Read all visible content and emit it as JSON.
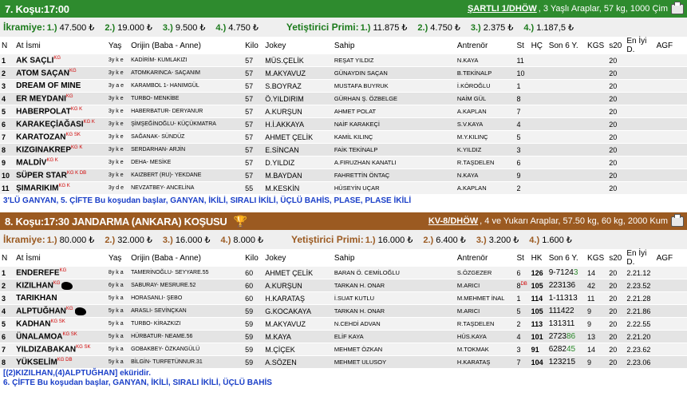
{
  "race7": {
    "title": "7. Koşu:17:00",
    "condition_code": "ŞARTLI 1/DHÖW",
    "condition_text": ", 3 Yaşlı Araplar, 57 kg, 1000 Çim",
    "prize_label": "İkramiye:",
    "prizes": [
      "1.) 47.500 ₺",
      "2.) 19.000 ₺",
      "3.) 9.500 ₺",
      "4.) 4.750 ₺"
    ],
    "breeder_label": "Yetiştirici Primi:",
    "breeder_prizes": [
      "1.) 11.875 ₺",
      "2.) 4.750 ₺",
      "3.) 2.375 ₺",
      "4.) 1.187,5 ₺"
    ],
    "columns": [
      "N",
      "At İsmi",
      "Yaş",
      "Orijin (Baba - Anne)",
      "Kilo",
      "Jokey",
      "Sahip",
      "Antrenör",
      "St",
      "HÇ",
      "Son 6 Y.",
      "KGS",
      "s20",
      "En İyi D.",
      "AGF"
    ],
    "rows": [
      {
        "no": "1",
        "name": "AK SAÇLI",
        "sup": "KG",
        "age": "3y k e",
        "origin": "KADİRİM- KUMLAKIZI",
        "kilo": "57",
        "jockey": "MÜS.ÇELİK",
        "owner": "REŞAT YILDIZ",
        "trainer": "N.KAYA",
        "st": "11",
        "hc": "",
        "son6": "",
        "kgs": "",
        "s20": "20",
        "best": "",
        "agf": ""
      },
      {
        "no": "2",
        "name": "ATOM SAÇAN",
        "sup": "KG",
        "age": "3y k e",
        "origin": "ATOMKARINCA- SAÇANIM",
        "kilo": "57",
        "jockey": "M.AKYAVUZ",
        "owner": "GÜNAYDIN SAÇAN",
        "trainer": "B.TEKİNALP",
        "st": "10",
        "hc": "",
        "son6": "",
        "kgs": "",
        "s20": "20",
        "best": "",
        "agf": ""
      },
      {
        "no": "3",
        "name": "DREAM OF MINE",
        "sup": "",
        "age": "3y a e",
        "origin": "KARAMBOL 1- HANIMGÜL",
        "kilo": "57",
        "jockey": "S.BOYRAZ",
        "owner": "MUSTAFA BUYRUK",
        "trainer": "İ.KÖROĞLU",
        "st": "1",
        "hc": "",
        "son6": "",
        "kgs": "",
        "s20": "20",
        "best": "",
        "agf": ""
      },
      {
        "no": "4",
        "name": "ER MEYDANI",
        "sup": "KG",
        "age": "3y k e",
        "origin": "TURBO- MENKİBE",
        "kilo": "57",
        "jockey": "Ö.YILDIRIM",
        "owner": "GÜRHAN Ş. ÖZBELGE",
        "trainer": "NAİM GÜL",
        "st": "8",
        "hc": "",
        "son6": "",
        "kgs": "",
        "s20": "20",
        "best": "",
        "agf": ""
      },
      {
        "no": "5",
        "name": "HABERPOLAT",
        "sup": "KG K",
        "age": "3y k e",
        "origin": "HABERBATUR- DERYANUR",
        "kilo": "57",
        "jockey": "A.KURŞUN",
        "owner": "AHMET POLAT",
        "trainer": "A.KAPLAN",
        "st": "7",
        "hc": "",
        "son6": "",
        "kgs": "",
        "s20": "20",
        "best": "",
        "agf": ""
      },
      {
        "no": "6",
        "name": "KARAKEÇİAĞASI",
        "sup": "KG K",
        "age": "3y k e",
        "origin": "ŞİMŞEĞİNOĞLU- KÜÇÜKMATRA",
        "kilo": "57",
        "jockey": "H.İ.AKKAYA",
        "owner": "NAİF KARAKEÇİ",
        "trainer": "S.V.KAYA",
        "st": "4",
        "hc": "",
        "son6": "",
        "kgs": "",
        "s20": "20",
        "best": "",
        "agf": ""
      },
      {
        "no": "7",
        "name": "KARATOZAN",
        "sup": "KG SK",
        "age": "3y k e",
        "origin": "SAĞANAK- SÜNDÜZ",
        "kilo": "57",
        "jockey": "AHMET ÇELİK",
        "owner": "KAMİL KILINÇ",
        "trainer": "M.Y.KILINÇ",
        "st": "5",
        "hc": "",
        "son6": "",
        "kgs": "",
        "s20": "20",
        "best": "",
        "agf": ""
      },
      {
        "no": "8",
        "name": "KIZGINAKREP",
        "sup": "KG K",
        "age": "3y k e",
        "origin": "SERDARHAN- ARJİN",
        "kilo": "57",
        "jockey": "E.SİNCAN",
        "owner": "FAİK TEKİNALP",
        "trainer": "K.YILDIZ",
        "st": "3",
        "hc": "",
        "son6": "",
        "kgs": "",
        "s20": "20",
        "best": "",
        "agf": ""
      },
      {
        "no": "9",
        "name": "MALDİV",
        "sup": "KG K",
        "age": "3y k e",
        "origin": "DEHA- MESİKE",
        "kilo": "57",
        "jockey": "D.YILDIZ",
        "owner": "A.FIRUZHAN KANATLI",
        "trainer": "R.TAŞDELEN",
        "st": "6",
        "hc": "",
        "son6": "",
        "kgs": "",
        "s20": "20",
        "best": "",
        "agf": ""
      },
      {
        "no": "10",
        "name": "SÜPER STAR",
        "sup": "KG K DB",
        "age": "3y k e",
        "origin": "KAIZBERT (RU)- YEKDANE",
        "kilo": "57",
        "jockey": "M.BAYDAN",
        "owner": "FAHRETTİN ÖNTAÇ",
        "trainer": "N.KAYA",
        "st": "9",
        "hc": "",
        "son6": "",
        "kgs": "",
        "s20": "20",
        "best": "",
        "agf": ""
      },
      {
        "no": "11",
        "name": "ŞIMARIKIM",
        "sup": "KG K",
        "age": "3y d e",
        "origin": "NEVZATBEY- ANCELİNA",
        "kilo": "55",
        "jockey": "M.KESKİN",
        "owner": "HÜSEYİN UÇAR",
        "trainer": "A.KAPLAN",
        "st": "2",
        "hc": "",
        "son6": "",
        "kgs": "",
        "s20": "20",
        "best": "",
        "agf": ""
      }
    ],
    "bets": "3'LÜ GANYAN, 5. ÇİFTE Bu koşudan başlar, GANYAN, İKİLİ, SIRALI İKİLİ, ÜÇLÜ BAHİS, PLASE, PLASE İKİLİ"
  },
  "race8": {
    "title": "8. Koşu:17:30 JANDARMA (ANKARA) KOŞUSU",
    "condition_code": "KV-8/DHÖW",
    "condition_text": ", 4 ve Yukarı Araplar, 57.50 kg, 60 kg, 2000 Kum",
    "prize_label": "İkramiye:",
    "prizes": [
      "1.) 80.000 ₺",
      "2.) 32.000 ₺",
      "3.) 16.000 ₺",
      "4.) 8.000 ₺"
    ],
    "breeder_label": "Yetiştirici Primi:",
    "breeder_prizes": [
      "1.) 16.000 ₺",
      "2.) 6.400 ₺",
      "3.) 3.200 ₺",
      "4.) 1.600 ₺"
    ],
    "columns": [
      "N",
      "At İsmi",
      "Yaş",
      "Orijin (Baba - Anne)",
      "Kilo",
      "Jokey",
      "Sahip",
      "Antrenör",
      "St",
      "HK",
      "Son 6 Y.",
      "KGS",
      "s20",
      "En İyi D.",
      "AGF"
    ],
    "rows": [
      {
        "no": "1",
        "name": "ENDEREFE",
        "sup": "KG",
        "age": "8y k a",
        "origin": "TAMERİNOĞLU- SEYYARE.55",
        "kilo": "60",
        "jockey": "AHMET ÇELİK",
        "owner": "BARAN Ö. CEMİLOĞLU",
        "trainer": "S.ÖZGEZER",
        "st": "6",
        "hk": "126",
        "son6": "9-7124",
        "son6g": "3",
        "kgs": "14",
        "s20": "20",
        "best": "2.21.12",
        "agf": ""
      },
      {
        "no": "2",
        "name": "KIZILHAN",
        "sup": "KG",
        "age": "6y k a",
        "origin": "SABURAY- MESRURE.52",
        "kilo": "60",
        "jockey": "A.KURŞUN",
        "owner": "TARKAN H. ONAR",
        "trainer": "M.ARICI",
        "st": "8",
        "stdb": "DB",
        "hk": "105",
        "son6": "223136",
        "son6g": "",
        "kgs": "42",
        "s20": "20",
        "best": "2.23.52",
        "agf": ""
      },
      {
        "no": "3",
        "name": "TARIKHAN",
        "sup": "",
        "age": "5y k a",
        "origin": "HORASANLI- ŞEBO",
        "kilo": "60",
        "jockey": "H.KARATAŞ",
        "owner": "İ.SUAT KUTLU",
        "trainer": "M.MEHMET İNAL",
        "st": "1",
        "hk": "114",
        "son6": "1-11313",
        "son6g": "",
        "kgs": "11",
        "s20": "20",
        "best": "2.21.28",
        "agf": ""
      },
      {
        "no": "4",
        "name": "ALPTUĞHAN",
        "sup": "KG",
        "age": "5y k a",
        "origin": "ARASLI- SEVİNÇKAN",
        "kilo": "59",
        "jockey": "G.KOCAKAYA",
        "owner": "TARKAN H. ONAR",
        "trainer": "M.ARICI",
        "st": "5",
        "hk": "105",
        "son6": "111422",
        "son6g": "",
        "kgs": "9",
        "s20": "20",
        "best": "2.21.86",
        "agf": ""
      },
      {
        "no": "5",
        "name": "KADHAN",
        "sup": "KG SK",
        "age": "5y k a",
        "origin": "TURBO- KİRAZKIZI",
        "kilo": "59",
        "jockey": "M.AKYAVUZ",
        "owner": "N.CEHDİ ADVAN",
        "trainer": "R.TAŞDELEN",
        "st": "2",
        "hk": "113",
        "son6": "131311",
        "son6g": "",
        "kgs": "9",
        "s20": "20",
        "best": "2.22.55",
        "agf": ""
      },
      {
        "no": "6",
        "name": "ÜNALAMOA",
        "sup": "KG SK",
        "age": "5y k a",
        "origin": "HÜRBATUR- NEAME.56",
        "kilo": "59",
        "jockey": "M.KAYA",
        "owner": "ELİF KAYA",
        "trainer": "HÜS.KAYA",
        "st": "4",
        "hk": "101",
        "son6": "2723",
        "son6g": "86",
        "kgs": "13",
        "s20": "20",
        "best": "2.21.20",
        "agf": ""
      },
      {
        "no": "7",
        "name": "YILDIZABAKAN",
        "sup": "KG SK",
        "age": "5y k a",
        "origin": "GOBAKBEY- ÖZKANGÜLÜ",
        "kilo": "59",
        "jockey": "M.ÇİÇEK",
        "owner": "MEHMET ÖZKAN",
        "trainer": "M.TOKMAK",
        "st": "3",
        "hk": "91",
        "son6": "6282",
        "son6g": "45",
        "kgs": "14",
        "s20": "20",
        "best": "2.23.62",
        "agf": ""
      },
      {
        "no": "8",
        "name": "YÜKSELİM",
        "sup": "KG DB",
        "age": "5y k a",
        "origin": "BİLGİN- TURFETÜNNUR.31",
        "kilo": "59",
        "jockey": "A.SÖZEN",
        "owner": "MEHMET ULUSOY",
        "trainer": "H.KARATAŞ",
        "st": "7",
        "hk": "104",
        "son6": "123215",
        "son6g": "",
        "kgs": "9",
        "s20": "20",
        "best": "2.23.06",
        "agf": ""
      }
    ],
    "note": "[(2)KIZILHAN,(4)ALPTUĞHAN] eküridir.",
    "bets": "6. ÇİFTE Bu koşudan başlar, GANYAN, İKİLİ, SIRALI İKİLİ, ÜÇLÜ BAHİS"
  },
  "icons": {
    "printer": "printer-icon",
    "trophy": "trophy-icon",
    "horse": "horse-icon"
  },
  "colors": {
    "green_header": "#2e8b2e",
    "brown_header": "#9b5a21",
    "bet_text": "#1a3fc8",
    "tag_red": "#d00000"
  }
}
